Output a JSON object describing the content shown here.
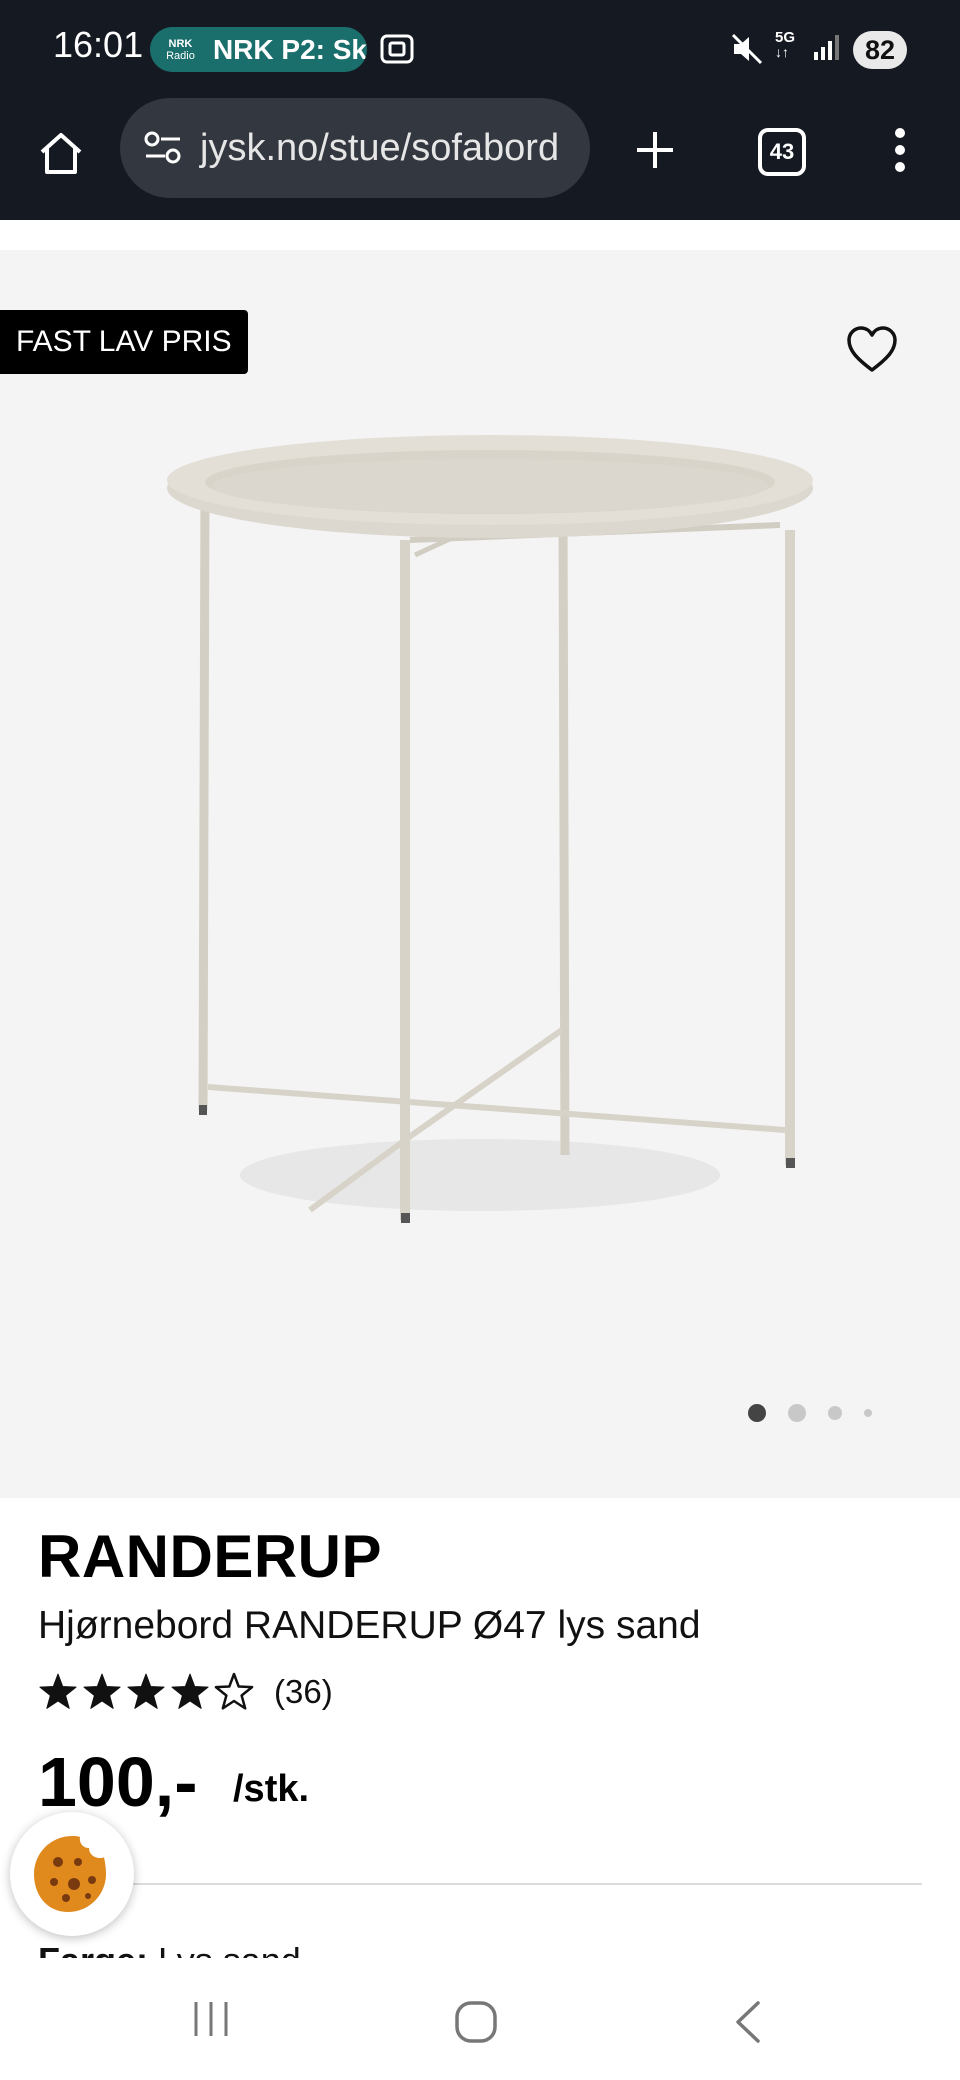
{
  "status_bar": {
    "time": "16:01",
    "radio_logo_top": "NRK",
    "radio_logo_bottom": "Radio",
    "radio_label": "NRK P2: Sk",
    "network": "5G",
    "battery": "82"
  },
  "browser": {
    "url": "jysk.no/stue/sofabord",
    "tab_count": "43"
  },
  "product": {
    "badge": "FAST LAV PRIS",
    "brand": "RANDERUP",
    "name": "Hjørnebord RANDERUP Ø47 lys sand",
    "rating": {
      "stars": 4,
      "max": 5,
      "count_label": "(36)"
    },
    "price": "100,-",
    "unit": "/stk.",
    "color_label": "Farge:",
    "color_value": "Lys sand",
    "image_dots": {
      "total": 4,
      "active": 1
    }
  },
  "colors": {
    "status_bg": "#151a22",
    "url_field_bg": "#33373f",
    "image_bg": "#f4f4f4",
    "table_color": "#d8d3c9",
    "radio_pill": "#1a6e6b"
  }
}
